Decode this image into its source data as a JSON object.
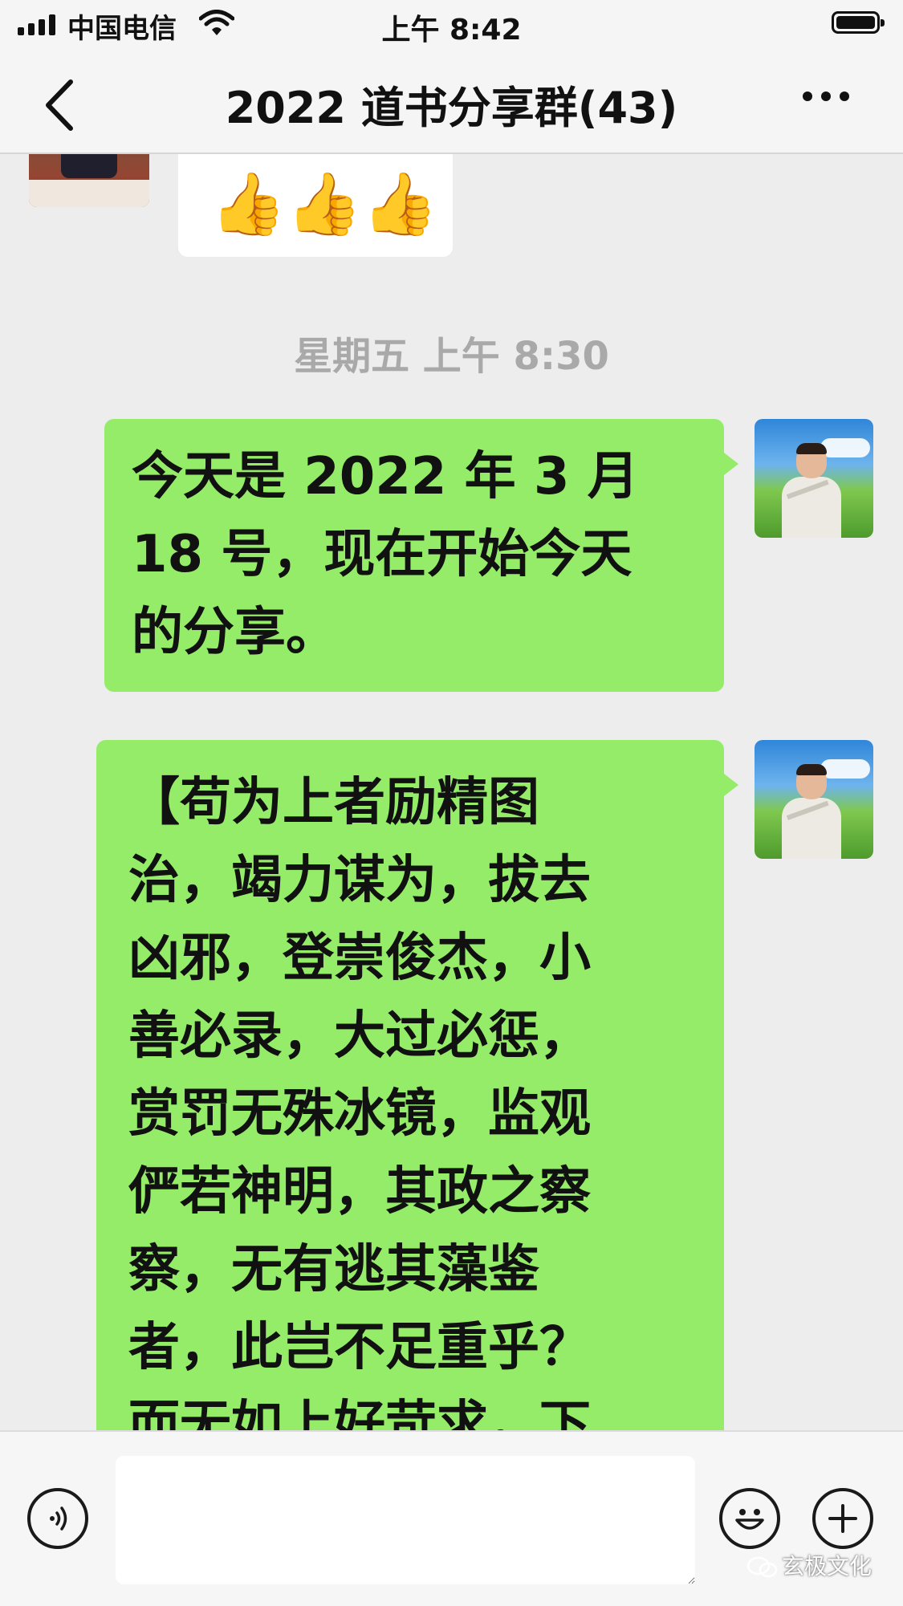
{
  "status_bar": {
    "carrier": "中国电信",
    "time": "上午 8:42",
    "icons": [
      "signal-icon",
      "wifi-icon",
      "battery-icon"
    ]
  },
  "nav": {
    "title": "2022 道书分享群(43)",
    "back_icon": "chevron-left-icon",
    "more_icon": "more-dots-icon"
  },
  "chat": {
    "prev_message": {
      "content": "👍👍👍",
      "type": "emoji"
    },
    "timestamp": "星期五 上午 8:30",
    "messages": [
      {
        "sender": "me",
        "text": "今天是 2022 年 3 月\n18 号，现在开始今天\n的分享。"
      },
      {
        "sender": "me",
        "text": "【苟为上者励精图\n治，竭力谋为，拔去\n凶邪，登崇俊杰，小\n善必录，大过必惩，\n赏罚无殊冰镜，监观\n俨若神明，其政之察\n察，无有逃其藻鉴\n者，此岂不足重乎？\n而无如上好苛求，下"
      }
    ]
  },
  "input_bar": {
    "voice_icon": "voice-icon",
    "emoji_icon": "emoji-icon",
    "plus_icon": "plus-icon",
    "input_value": ""
  },
  "watermark": "玄极文化",
  "colors": {
    "bubble_green": "#95ec69",
    "background": "#ededed",
    "bar": "#f5f5f5"
  }
}
